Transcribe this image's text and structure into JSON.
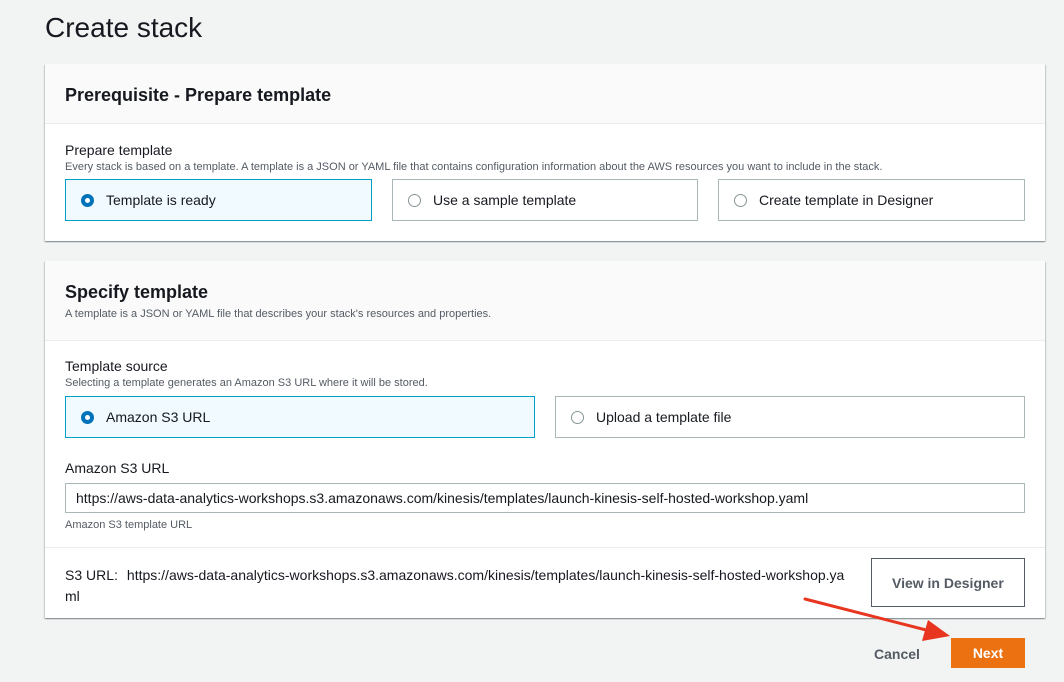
{
  "page": {
    "title": "Create stack"
  },
  "prerequisite": {
    "title": "Prerequisite - Prepare template",
    "field_label": "Prepare template",
    "field_description": "Every stack is based on a template. A template is a JSON or YAML file that contains configuration information about the AWS resources you want to include in the stack.",
    "options": [
      {
        "label": "Template is ready",
        "selected": true
      },
      {
        "label": "Use a sample template",
        "selected": false
      },
      {
        "label": "Create template in Designer",
        "selected": false
      }
    ]
  },
  "specify": {
    "title": "Specify template",
    "description": "A template is a JSON or YAML file that describes your stack's resources and properties.",
    "source_label": "Template source",
    "source_description": "Selecting a template generates an Amazon S3 URL where it will be stored.",
    "options": [
      {
        "label": "Amazon S3 URL",
        "selected": true
      },
      {
        "label": "Upload a template file",
        "selected": false
      }
    ],
    "url_label": "Amazon S3 URL",
    "url_value": "https://aws-data-analytics-workshops.s3.amazonaws.com/kinesis/templates/launch-kinesis-self-hosted-workshop.yaml",
    "url_hint": "Amazon S3 template URL",
    "s3_label": "S3 URL:",
    "s3_value": "https://aws-data-analytics-workshops.s3.amazonaws.com/kinesis/templates/launch-kinesis-self-hosted-workshop.yaml",
    "designer_button": "View in Designer"
  },
  "footer": {
    "cancel_label": "Cancel",
    "next_label": "Next"
  },
  "colors": {
    "accent_orange": "#ec7211",
    "selected_blue": "#0073bb",
    "selected_border": "#00a1c9",
    "annotation_red": "#e8351f"
  },
  "icons": {
    "radio": "radio-button-icon",
    "annotation": "red-arrow-icon"
  }
}
